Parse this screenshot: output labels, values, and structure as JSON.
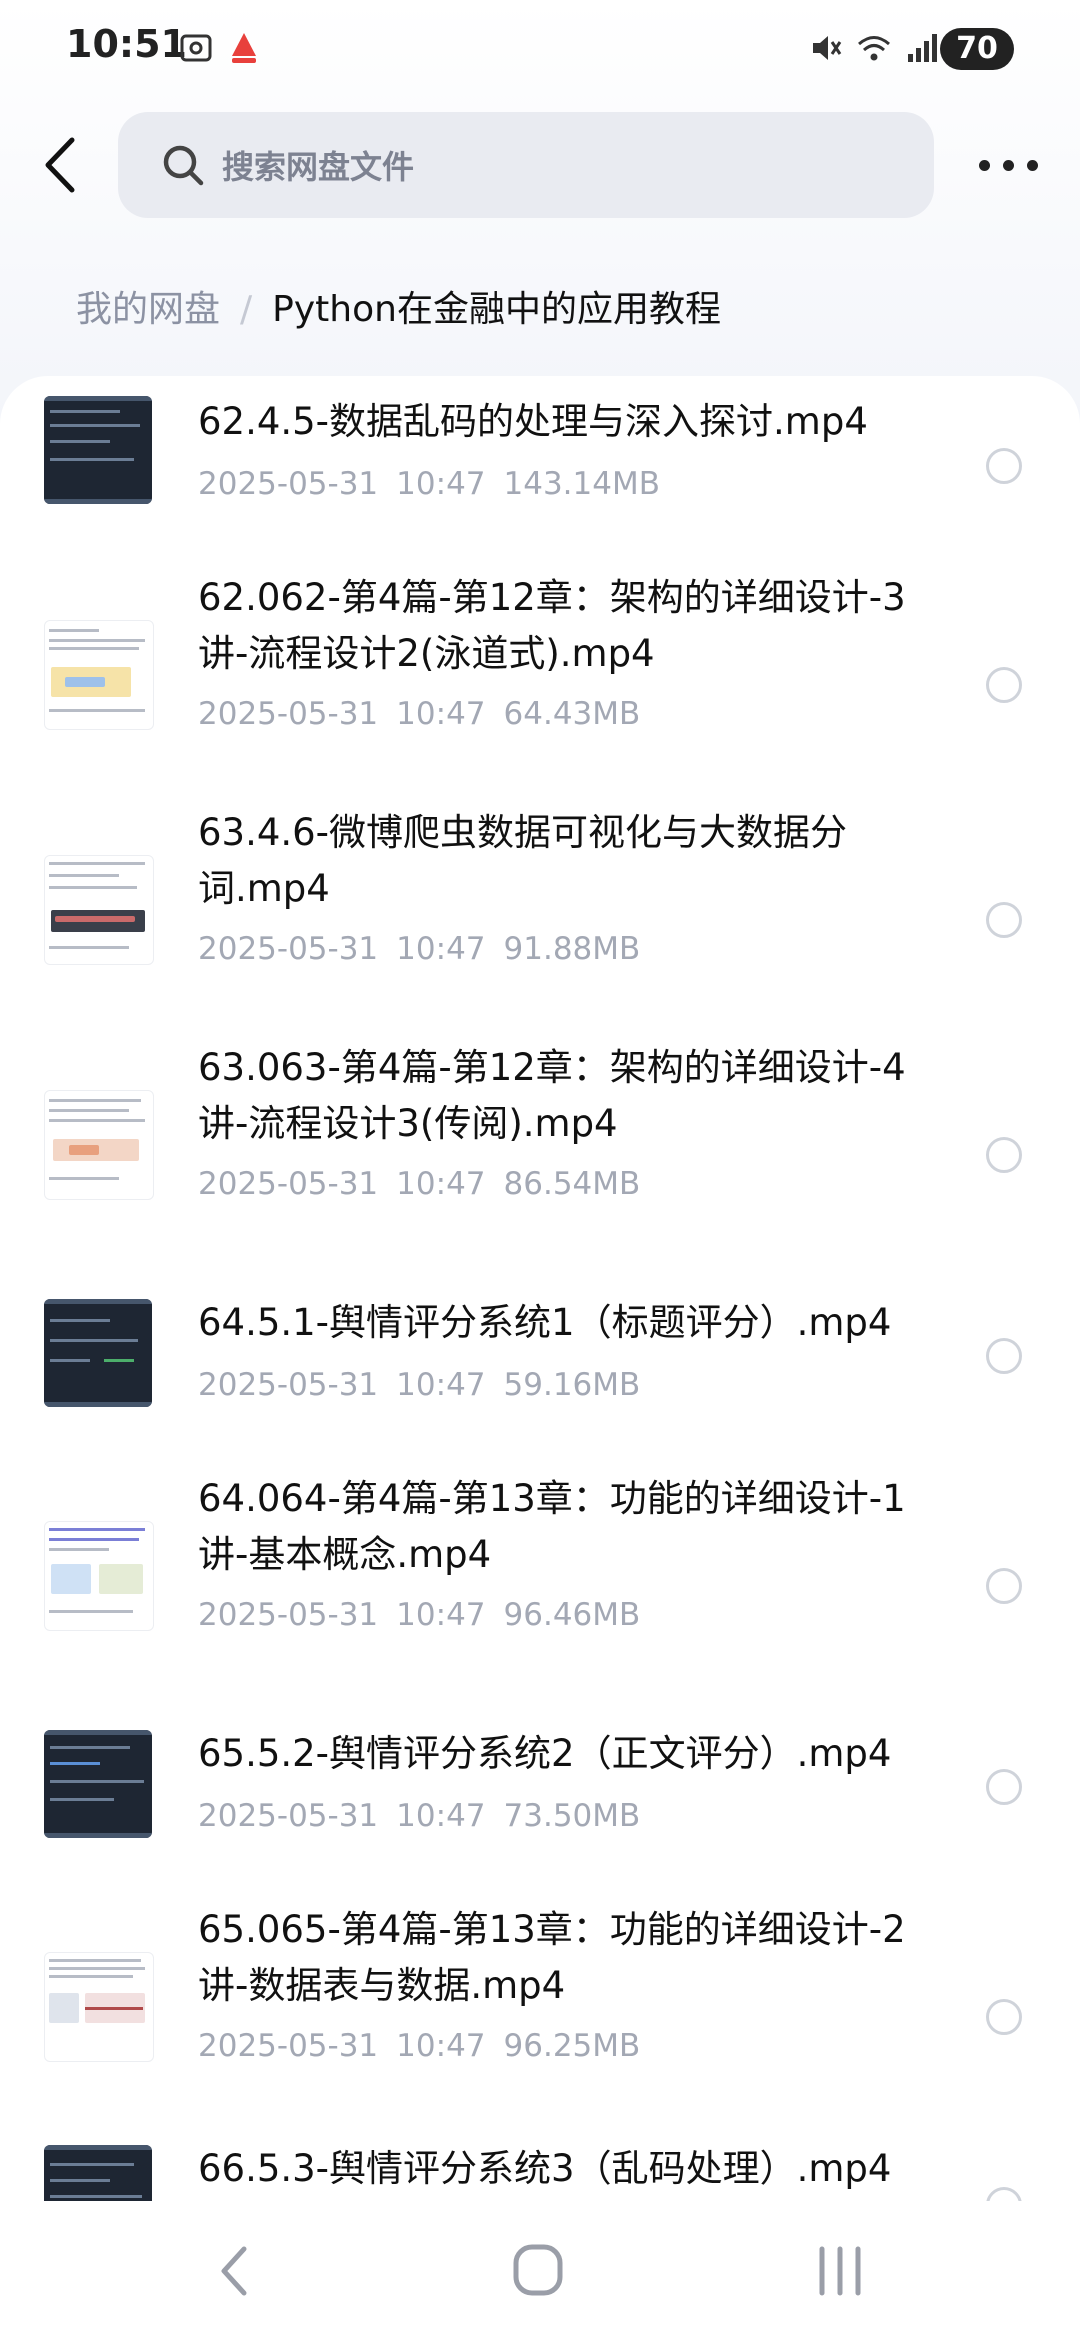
{
  "status_bar": {
    "time": "10:51",
    "battery": "70",
    "icons": [
      "screenshot-icon",
      "app-notification-icon",
      "mute-icon",
      "wifi-icon",
      "signal-icon",
      "battery-icon"
    ]
  },
  "header": {
    "back_icon": "chevron-left-icon",
    "search_placeholder": "搜索网盘文件",
    "more_icon": "more-horizontal-icon"
  },
  "breadcrumb": {
    "root": "我的网盘",
    "separator": "/",
    "current": "Python在金融中的应用教程"
  },
  "files": [
    {
      "name": "62.4.5-数据乱码的处理与深入探讨.mp4",
      "date": "2025-05-31",
      "time": "10:47",
      "size": "143.14MB",
      "thumb": "dark"
    },
    {
      "name": "62.062-第4篇-第12章：架构的详细设计-3讲-流程设计2(泳道式).mp4",
      "date": "2025-05-31",
      "time": "10:47",
      "size": "64.43MB",
      "thumb": "light"
    },
    {
      "name": "63.4.6-微博爬虫数据可视化与大数据分词.mp4",
      "date": "2025-05-31",
      "time": "10:47",
      "size": "91.88MB",
      "thumb": "light"
    },
    {
      "name": "63.063-第4篇-第12章：架构的详细设计-4讲-流程设计3(传阅).mp4",
      "date": "2025-05-31",
      "time": "10:47",
      "size": "86.54MB",
      "thumb": "light"
    },
    {
      "name": "64.5.1-舆情评分系统1（标题评分）.mp4",
      "date": "2025-05-31",
      "time": "10:47",
      "size": "59.16MB",
      "thumb": "dark"
    },
    {
      "name": "64.064-第4篇-第13章：功能的详细设计-1讲-基本概念.mp4",
      "date": "2025-05-31",
      "time": "10:47",
      "size": "96.46MB",
      "thumb": "light"
    },
    {
      "name": "65.5.2-舆情评分系统2（正文评分）.mp4",
      "date": "2025-05-31",
      "time": "10:47",
      "size": "73.50MB",
      "thumb": "dark"
    },
    {
      "name": "65.065-第4篇-第13章：功能的详细设计-2讲-数据表与数据.mp4",
      "date": "2025-05-31",
      "time": "10:47",
      "size": "96.25MB",
      "thumb": "light"
    },
    {
      "name": "66.5.3-舆情评分系统3（乱码处理）.mp4",
      "date": "",
      "time": "",
      "size": "",
      "thumb": "dark"
    }
  ],
  "nav_bar": {
    "back_icon": "nav-back-icon",
    "home_icon": "nav-home-icon",
    "recents_icon": "nav-recents-icon"
  },
  "colors": {
    "page_bg": "#f4f5f9",
    "search_bg": "#e9ebf1",
    "secondary_text": "#a3a8b4",
    "breadcrumb_root": "#8c92a3"
  }
}
